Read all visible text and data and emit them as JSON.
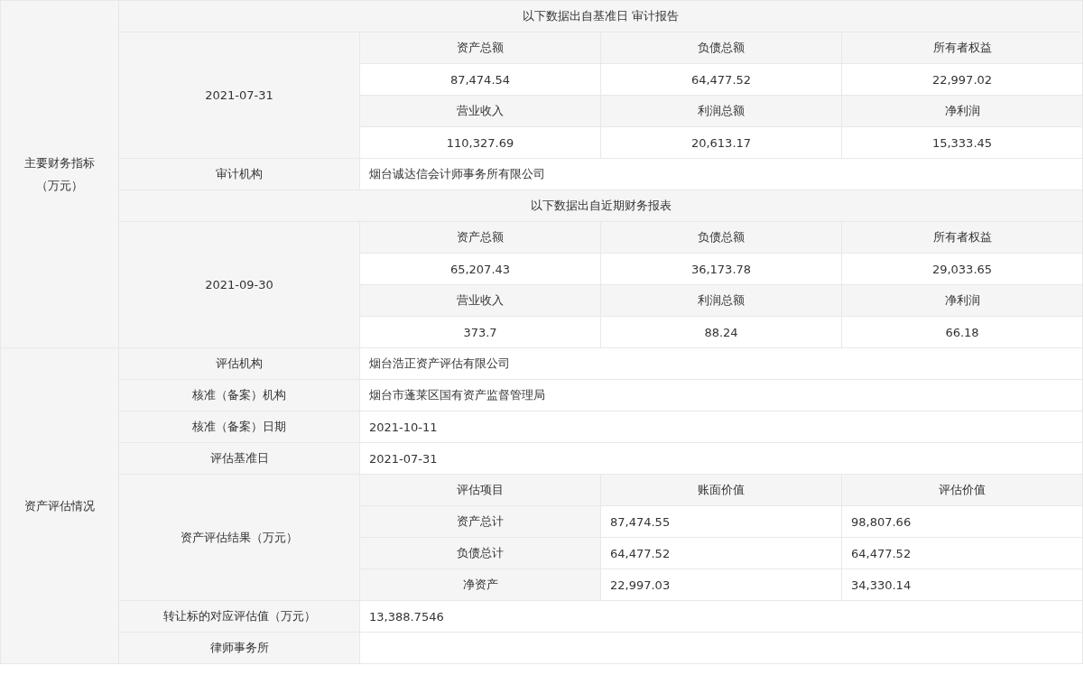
{
  "financial": {
    "label": "主要财务指标（万元）",
    "reports": [
      {
        "title": "以下数据出自基准日 审计报告",
        "date": "2021-07-31",
        "metrics": [
          {
            "name": "资产总额",
            "value": "87,474.54"
          },
          {
            "name": "负债总额",
            "value": "64,477.52"
          },
          {
            "name": "所有者权益",
            "value": "22,997.02"
          },
          {
            "name": "营业收入",
            "value": "110,327.69"
          },
          {
            "name": "利润总额",
            "value": "20,613.17"
          },
          {
            "name": "净利润",
            "value": "15,333.45"
          }
        ],
        "auditor": {
          "label": "审计机构",
          "value": "烟台诚达信会计师事务所有限公司"
        }
      },
      {
        "title": "以下数据出自近期财务报表",
        "date": "2021-09-30",
        "metrics": [
          {
            "name": "资产总额",
            "value": "65,207.43"
          },
          {
            "name": "负债总额",
            "value": "36,173.78"
          },
          {
            "name": "所有者权益",
            "value": "29,033.65"
          },
          {
            "name": "营业收入",
            "value": "373.7"
          },
          {
            "name": "利润总额",
            "value": "88.24"
          },
          {
            "name": "净利润",
            "value": "66.18"
          }
        ]
      }
    ]
  },
  "valuation": {
    "label": "资产评估情况",
    "fields": [
      {
        "label": "评估机构",
        "value": "烟台浩正资产评估有限公司"
      },
      {
        "label": "核准（备案）机构",
        "value": "烟台市蓬莱区国有资产监督管理局"
      },
      {
        "label": "核准（备案）日期",
        "value": "2021-10-11"
      },
      {
        "label": "评估基准日",
        "value": "2021-07-31"
      }
    ],
    "result": {
      "label": "资产评估结果（万元）",
      "columns": [
        "评估项目",
        "账面价值",
        "评估价值"
      ],
      "rows": [
        {
          "item": "资产总计",
          "book_value": "87,474.55",
          "appraised_value": "98,807.66"
        },
        {
          "item": "负债总计",
          "book_value": "64,477.52",
          "appraised_value": "64,477.52"
        },
        {
          "item": "净资产",
          "book_value": "22,997.03",
          "appraised_value": "34,330.14"
        }
      ]
    },
    "after_fields": [
      {
        "label": "转让标的对应评估值（万元）",
        "value": "13,388.7546"
      },
      {
        "label": "律师事务所"
      }
    ]
  }
}
